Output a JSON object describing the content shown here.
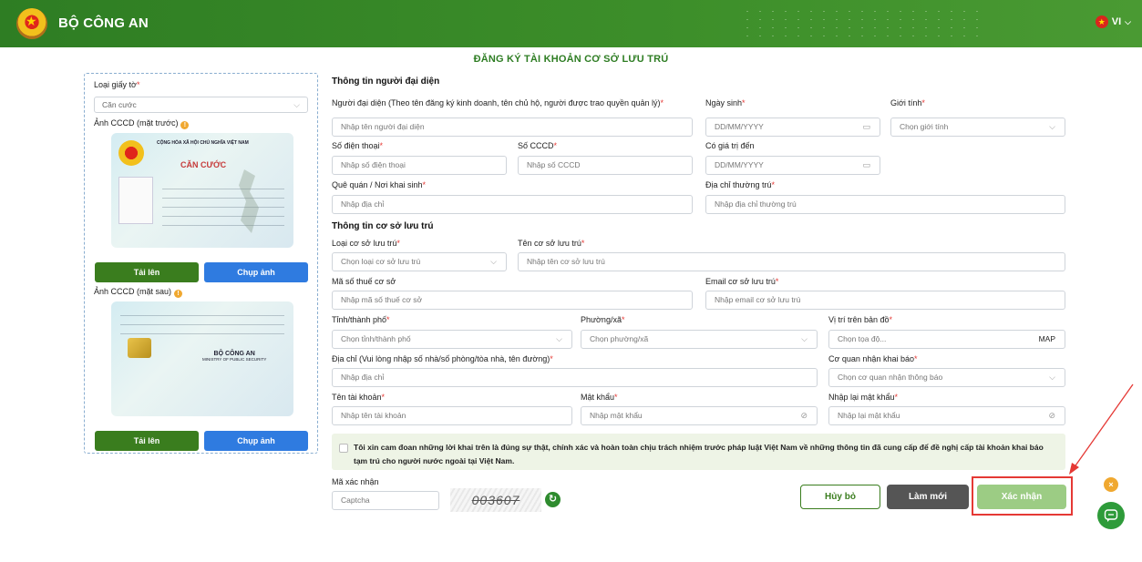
{
  "header": {
    "org": "BỘ CÔNG AN",
    "lang": "VI",
    "brand_color": "#2e7d23"
  },
  "page_title": "ĐĂNG KÝ TÀI KHOẢN CƠ SỞ LƯU TRÚ",
  "left": {
    "doc_type_label": "Loại giấy tờ",
    "doc_type_value": "Căn cước",
    "front_label": "Ảnh CCCD (mặt trước)",
    "back_label": "Ảnh CCCD (mặt sau)",
    "upload": "Tải lên",
    "capture": "Chụp ảnh",
    "card_front": {
      "header": "CỘNG HÒA XÃ HỘI CHỦ NGHĨA VIỆT NAM",
      "title": "CĂN CƯỚC"
    },
    "card_back": {
      "org": "BỘ CÔNG AN",
      "org_en": "MINISTRY OF PUBLIC SECURITY"
    }
  },
  "rep": {
    "section": "Thông tin người đại diện",
    "name_label": "Người đại diện (Theo tên đăng ký kinh doanh, tên chủ hộ, người được trao quyền quản lý)",
    "name_ph": "Nhập tên người đại diện",
    "dob_label": "Ngày sinh",
    "dob_ph": "DD/MM/YYYY",
    "gender_label": "Giới tính",
    "gender_ph": "Chọn giới tính",
    "phone_label": "Số điện thoại",
    "phone_ph": "Nhập số điện thoại",
    "cccd_label": "Số CCCD",
    "cccd_ph": "Nhập số CCCD",
    "valid_label": "Có giá trị đến",
    "valid_ph": "DD/MM/YYYY",
    "home_label": "Quê quán / Nơi khai sinh",
    "home_ph": "Nhập địa chỉ",
    "perm_label": "Địa chỉ thường trú",
    "perm_ph": "Nhập địa chỉ thường trú"
  },
  "facility": {
    "section": "Thông tin cơ sở lưu trú",
    "type_label": "Loại cơ sở lưu trú",
    "type_ph": "Chọn loại cơ sở lưu trú",
    "name_label": "Tên cơ sở lưu trú",
    "name_ph": "Nhập tên cơ sở lưu trú",
    "tax_label": "Mã số thuế cơ sở",
    "tax_ph": "Nhập mã số thuế cơ sở",
    "email_label": "Email cơ sở lưu trú",
    "email_ph": "Nhập email cơ sở lưu trú",
    "province_label": "Tỉnh/thành phố",
    "province_ph": "Chọn tỉnh/thành phố",
    "ward_label": "Phường/xã",
    "ward_ph": "Chọn phường/xã",
    "map_label": "Vị trí trên bản đồ",
    "map_ph": "Chọn tọa độ...",
    "map_btn": "MAP",
    "addr_label": "Địa chỉ (Vui lòng nhập số nhà/số phòng/tòa nhà, tên đường)",
    "addr_ph": "Nhập địa chỉ",
    "agency_label": "Cơ quan nhận khai báo",
    "agency_ph": "Chọn cơ quan nhận thông báo",
    "user_label": "Tên tài khoản",
    "user_ph": "Nhập tên tài khoản",
    "pass_label": "Mật khẩu",
    "pass_ph": "Nhập mật khẩu",
    "repass_label": "Nhập lại mật khẩu",
    "repass_ph": "Nhập lại mật khẩu"
  },
  "commitment": "Tôi xin cam đoan những lời khai trên là đúng sự thật, chính xác và hoàn toàn chịu trách nhiệm trước pháp luật Việt Nam về những thông tin đã cung cấp để đề nghị cấp tài khoản khai báo tạm trú cho người nước ngoài tại Việt Nam.",
  "captcha": {
    "label": "Mã xác nhận",
    "ph": "Captcha",
    "code": "003607"
  },
  "actions": {
    "cancel": "Hủy bỏ",
    "reset": "Làm mới",
    "submit": "Xác nhận"
  }
}
